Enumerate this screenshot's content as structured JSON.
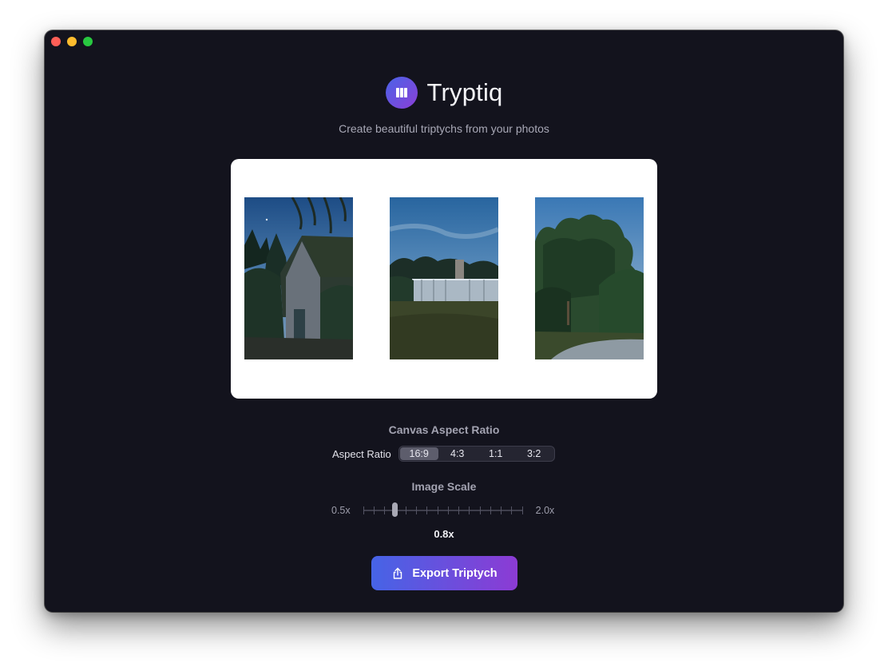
{
  "app": {
    "title": "Tryptiq",
    "subtitle": "Create beautiful triptychs from your photos",
    "logo_icon": "columns-icon",
    "accent_start": "#4a63e8",
    "accent_end": "#8b3fd6"
  },
  "canvas": {
    "photos": [
      {
        "name": "photo-garden-shed"
      },
      {
        "name": "photo-greenhouse"
      },
      {
        "name": "photo-tree-path"
      }
    ]
  },
  "aspect": {
    "section_title": "Canvas Aspect Ratio",
    "label": "Aspect Ratio",
    "options": [
      "16:9",
      "4:3",
      "1:1",
      "3:2"
    ],
    "selected": "16:9"
  },
  "scale": {
    "section_title": "Image Scale",
    "min_label": "0.5x",
    "max_label": "2.0x",
    "min": 0.5,
    "max": 2.0,
    "value": 0.8,
    "value_label": "0.8x"
  },
  "export": {
    "label": "Export Triptych",
    "icon": "share-icon"
  }
}
